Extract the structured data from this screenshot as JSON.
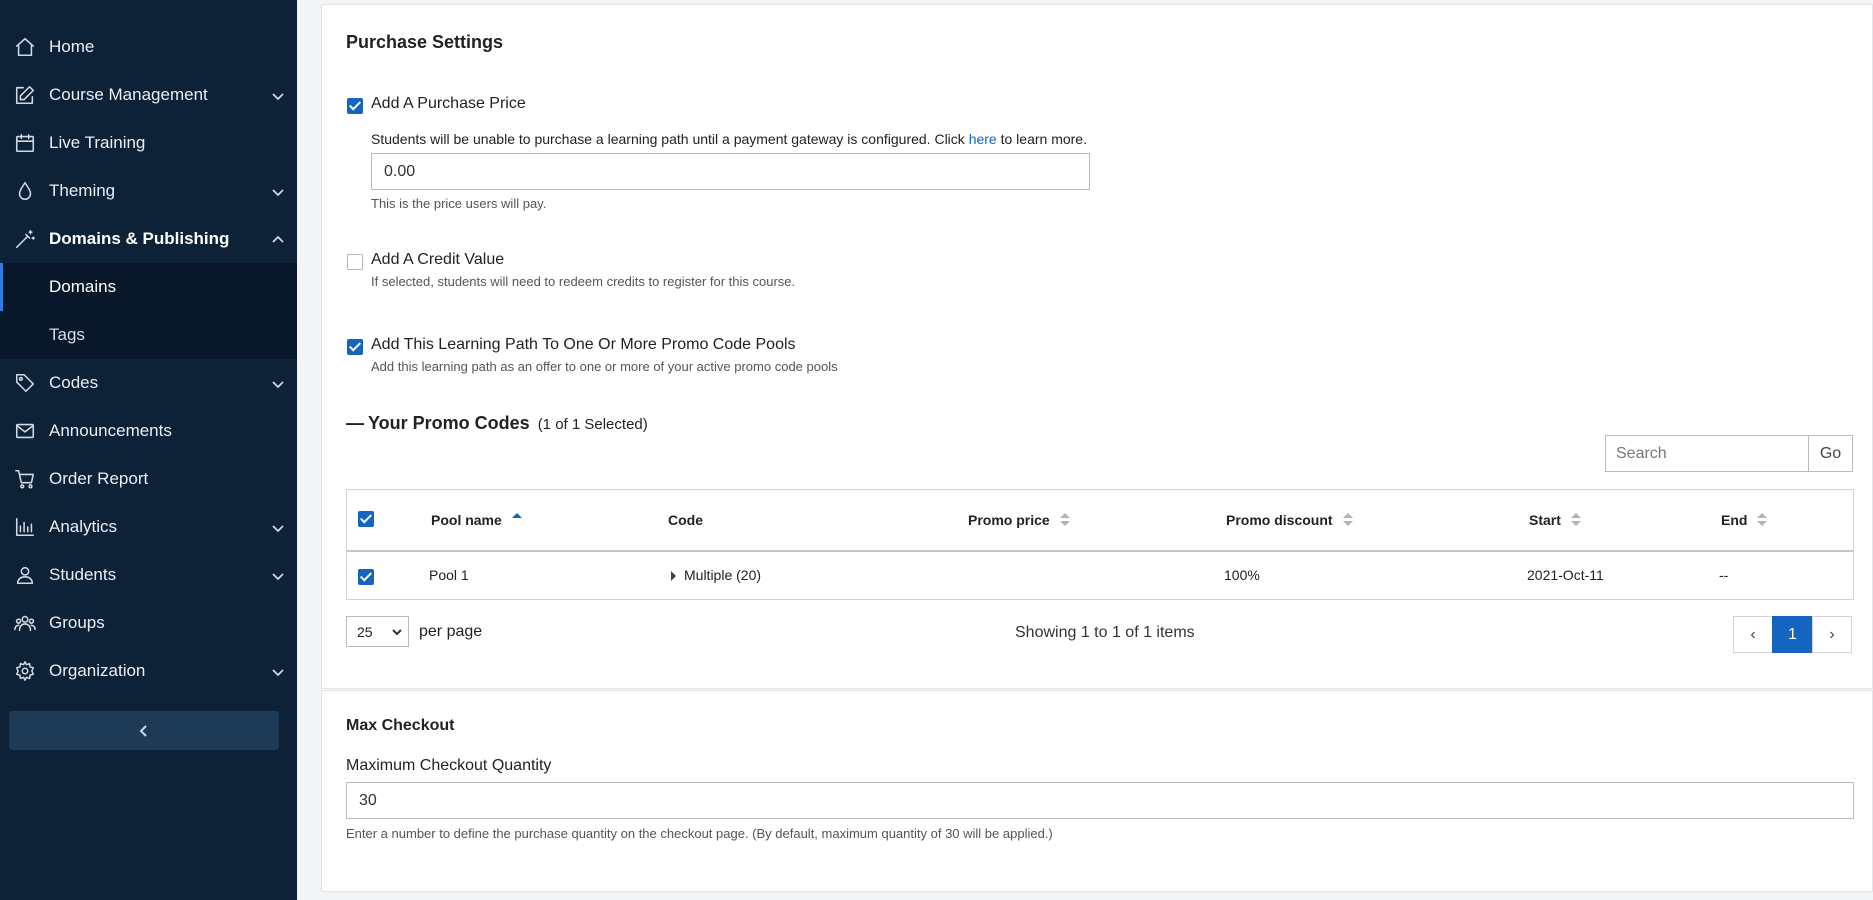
{
  "sidebar": {
    "items": [
      {
        "label": "Home",
        "icon": "home-icon"
      },
      {
        "label": "Course Management",
        "icon": "edit-icon"
      },
      {
        "label": "Live Training",
        "icon": "calendar-icon"
      },
      {
        "label": "Theming",
        "icon": "droplet-icon"
      },
      {
        "label": "Domains & Publishing",
        "icon": "magic-wand-icon"
      },
      {
        "label": "Codes",
        "icon": "tag-icon"
      },
      {
        "label": "Announcements",
        "icon": "mail-icon"
      },
      {
        "label": "Order Report",
        "icon": "cart-icon"
      },
      {
        "label": "Analytics",
        "icon": "bar-chart-icon"
      },
      {
        "label": "Students",
        "icon": "user-icon"
      },
      {
        "label": "Groups",
        "icon": "users-icon"
      },
      {
        "label": "Organization",
        "icon": "gear-icon"
      }
    ],
    "subitems": [
      {
        "label": "Domains"
      },
      {
        "label": "Tags"
      }
    ]
  },
  "purchase": {
    "title": "Purchase Settings",
    "price_option": "Add A Purchase Price",
    "price_note_before": "Students will be unable to purchase a learning path until a payment gateway is configured. Click ",
    "price_note_link": "here",
    "price_note_after": " to learn more.",
    "price_value": "0.00",
    "price_help": "This is the price users will pay.",
    "credit_option": "Add A Credit Value",
    "credit_help": "If selected, students will need to redeem credits to register for this course.",
    "promo_option": "Add This Learning Path To One Or More Promo Code Pools",
    "promo_help": "Add this learning path as an offer to one or more of your active promo code pools"
  },
  "promo_codes": {
    "toggle": "—",
    "title": "Your Promo Codes",
    "count": "(1 of 1 Selected)",
    "search_placeholder": "Search",
    "go_label": "Go",
    "columns": [
      "Pool name",
      "Code",
      "Promo price",
      "Promo discount",
      "Start",
      "End"
    ],
    "rows": [
      {
        "pool": "Pool 1",
        "code": "Multiple (20)",
        "price": "",
        "discount": "100%",
        "start": "2021-Oct-11",
        "end": "--"
      }
    ],
    "per_page_value": "25",
    "per_page_label": "per page",
    "showing": "Showing 1 to 1 of 1 items",
    "prev": "‹",
    "page": "1",
    "next": "›"
  },
  "max_checkout": {
    "title": "Max Checkout",
    "label": "Maximum Checkout Quantity",
    "value": "30",
    "help": "Enter a number to define the purchase quantity on the checkout page. (By default, maximum quantity of 30 will be applied.)"
  },
  "colors": {
    "sidebar_bg": "#0d2137",
    "accent": "#1565c0"
  }
}
